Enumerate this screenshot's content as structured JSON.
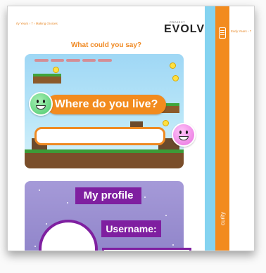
{
  "page": {
    "breadcrumb": "rly Years › 7 › Making choices",
    "logo": {
      "small": "PROJECT",
      "main": "EVOLVE"
    },
    "heading": "What could you say?"
  },
  "game": {
    "question": "Where do you live?"
  },
  "profile": {
    "title": "My profile",
    "username_label": "Username:"
  },
  "sidebar": {
    "crumb": "Early Years › 7",
    "vertical_text": "curity"
  },
  "colors": {
    "orange": "#f28b1e",
    "purple": "#7f1fa0",
    "cyan": "#84d3f0"
  }
}
